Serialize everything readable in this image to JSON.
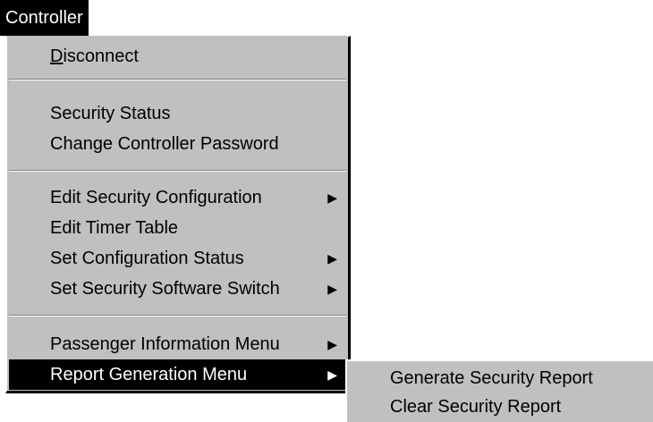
{
  "menubar": {
    "title": "Controller"
  },
  "menu": {
    "disconnect": {
      "accel": "D",
      "rest": "isconnect"
    },
    "items_group2": [
      {
        "label": "Security Status"
      },
      {
        "label": "Change Controller Password"
      }
    ],
    "items_group3": [
      {
        "label": "Edit Security Configuration",
        "has_submenu": true
      },
      {
        "label": "Edit Timer Table",
        "has_submenu": false
      },
      {
        "label": "Set Configuration Status",
        "has_submenu": true
      },
      {
        "label": "Set Security Software Switch",
        "has_submenu": true
      }
    ],
    "items_group4": [
      {
        "label": "Passenger Information Menu",
        "has_submenu": true
      },
      {
        "label": "Report Generation Menu",
        "has_submenu": true,
        "selected": true
      }
    ],
    "arrow_glyph": "▶"
  },
  "submenu": {
    "items": [
      {
        "label": "Generate Security Report"
      },
      {
        "label": "Clear Security Report"
      }
    ]
  },
  "colors": {
    "menu_face": "#c0c0c0",
    "highlight": "#000000",
    "highlight_text": "#ffffff"
  }
}
